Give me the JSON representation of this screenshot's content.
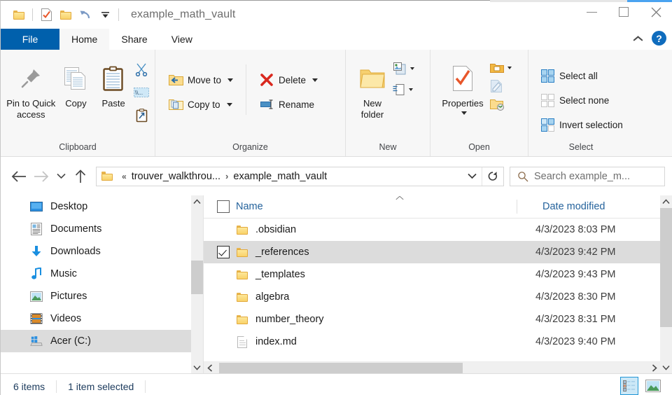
{
  "window": {
    "title": "example_math_vault",
    "quick_access": [
      {
        "name": "folder-icon",
        "label": "Explorer"
      },
      {
        "name": "properties-icon",
        "label": "Properties"
      },
      {
        "name": "new-folder-icon",
        "label": "New folder"
      },
      {
        "name": "redo-icon",
        "label": "Redo"
      },
      {
        "name": "customize-qat-icon",
        "label": "Customize Quick Access Toolbar"
      }
    ],
    "controls": {
      "minimize": "Minimize",
      "maximize": "Maximize",
      "close": "Close"
    }
  },
  "ribbon": {
    "tabs": [
      {
        "label": "File",
        "state": "file"
      },
      {
        "label": "Home",
        "state": "active"
      },
      {
        "label": "Share",
        "state": "normal"
      },
      {
        "label": "View",
        "state": "normal"
      }
    ],
    "collapse_label": "Minimize the Ribbon",
    "help_label": "?",
    "groups": [
      {
        "title": "Clipboard",
        "big": [
          {
            "label": "Pin to Quick access",
            "icon": "pin-icon"
          },
          {
            "label": "Copy",
            "icon": "copy-icon"
          },
          {
            "label": "Paste",
            "icon": "paste-icon"
          }
        ],
        "small": [
          {
            "label": "Cut",
            "icon": "scissors-icon"
          },
          {
            "label": "Copy path",
            "icon": "copy-path-icon"
          },
          {
            "label": "Paste shortcut",
            "icon": "paste-shortcut-icon"
          }
        ]
      },
      {
        "title": "Organize",
        "items": [
          {
            "label": "Move to",
            "icon": "move-to-icon",
            "dropdown": true
          },
          {
            "label": "Delete",
            "icon": "delete-icon",
            "dropdown": true
          },
          {
            "label": "Copy to",
            "icon": "copy-to-icon",
            "dropdown": true
          },
          {
            "label": "Rename",
            "icon": "rename-icon",
            "dropdown": false
          }
        ]
      },
      {
        "title": "New",
        "big": [
          {
            "label": "New folder",
            "icon": "new-folder-icon"
          }
        ],
        "small": [
          {
            "label": "New item",
            "icon": "new-item-icon",
            "dropdown": true
          },
          {
            "label": "Easy access",
            "icon": "easy-access-icon",
            "dropdown": true
          }
        ]
      },
      {
        "title": "Open",
        "big": [
          {
            "label": "Properties",
            "icon": "properties-icon",
            "dropdown": true
          }
        ],
        "small": [
          {
            "label": "Open",
            "icon": "open-icon",
            "dropdown": true
          },
          {
            "label": "Edit",
            "icon": "edit-icon",
            "dropdown": false
          },
          {
            "label": "History",
            "icon": "history-icon",
            "dropdown": false
          }
        ]
      },
      {
        "title": "Select",
        "items": [
          {
            "label": "Select all",
            "icon": "select-all-icon"
          },
          {
            "label": "Select none",
            "icon": "select-none-icon"
          },
          {
            "label": "Invert selection",
            "icon": "invert-selection-icon"
          }
        ]
      }
    ]
  },
  "address": {
    "back_label": "Back",
    "forward_label": "Forward",
    "recent_label": "Recent locations",
    "up_label": "Up",
    "overflow": "«",
    "crumbs": [
      "trouver_walkthrou...",
      "example_math_vault"
    ],
    "separator": "›",
    "dropdown_label": "Previous locations",
    "refresh_label": "Refresh",
    "search_placeholder": "Search example_m..."
  },
  "nav_pane": {
    "items": [
      {
        "label": "Desktop",
        "icon": "desktop-icon",
        "selected": false
      },
      {
        "label": "Documents",
        "icon": "documents-icon",
        "selected": false
      },
      {
        "label": "Downloads",
        "icon": "downloads-icon",
        "selected": false
      },
      {
        "label": "Music",
        "icon": "music-icon",
        "selected": false
      },
      {
        "label": "Pictures",
        "icon": "pictures-icon",
        "selected": false
      },
      {
        "label": "Videos",
        "icon": "videos-icon",
        "selected": false
      },
      {
        "label": "Acer (C:)",
        "icon": "drive-icon",
        "selected": true
      }
    ]
  },
  "file_list": {
    "columns": [
      {
        "label": "Name",
        "sorted": "asc"
      },
      {
        "label": "Date modified",
        "sorted": null
      }
    ],
    "rows": [
      {
        "name": ".obsidian",
        "date": "4/3/2023 8:03 PM",
        "icon": "folder-icon",
        "checked": false,
        "selected": false
      },
      {
        "name": "_references",
        "date": "4/3/2023 9:42 PM",
        "icon": "folder-icon",
        "checked": true,
        "selected": true
      },
      {
        "name": "_templates",
        "date": "4/3/2023 9:43 PM",
        "icon": "folder-icon",
        "checked": false,
        "selected": false
      },
      {
        "name": "algebra",
        "date": "4/3/2023 8:30 PM",
        "icon": "folder-icon",
        "checked": false,
        "selected": false
      },
      {
        "name": "number_theory",
        "date": "4/3/2023 8:31 PM",
        "icon": "folder-icon",
        "checked": false,
        "selected": false
      },
      {
        "name": "index.md",
        "date": "4/3/2023 9:40 PM",
        "icon": "document-icon",
        "checked": false,
        "selected": false
      }
    ]
  },
  "status_bar": {
    "item_count": "6 items",
    "selection": "1 item selected",
    "views": [
      {
        "name": "details-view-button",
        "label": "Details view",
        "active": true
      },
      {
        "name": "large-icons-view-button",
        "label": "Large icons view",
        "active": false
      }
    ]
  },
  "colors": {
    "file_tab": "#0060ac",
    "accent_blue": "#0f6cbd",
    "selection_grey": "#dcdcdc",
    "column_header_text": "#25639c",
    "folder_yellow": "#f9d26a",
    "view_active": "#cce8f7"
  }
}
